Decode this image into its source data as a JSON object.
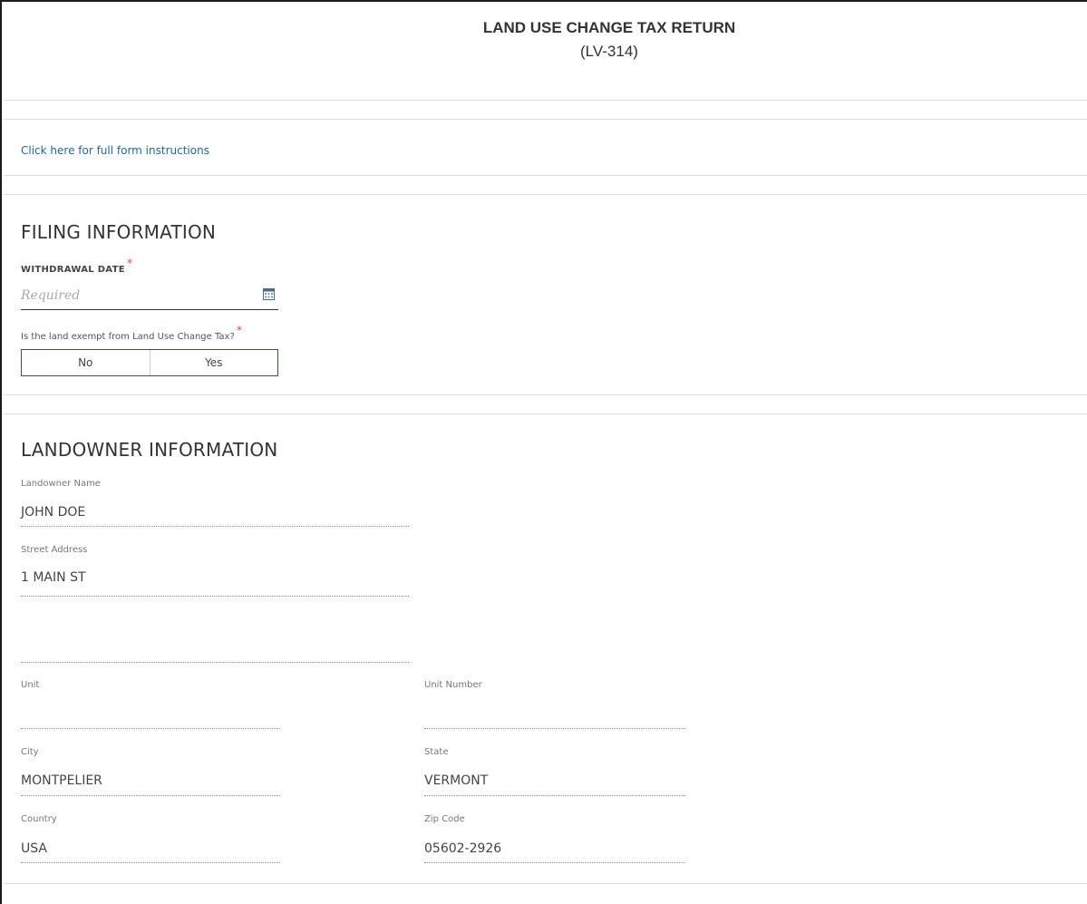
{
  "form": {
    "title": "LAND USE CHANGE TAX RETURN",
    "form_code": "(LV-314)",
    "instructions_link": "Click here for full form instructions"
  },
  "filing": {
    "heading": "FILING INFORMATION",
    "withdrawal_date_label": "WITHDRAWAL DATE",
    "required_mark": "*",
    "withdrawal_date_value": "",
    "withdrawal_date_placeholder": "Required",
    "exempt_question": "Is the land exempt from Land Use Change Tax?",
    "exempt_options": [
      "No",
      "Yes"
    ]
  },
  "landowner": {
    "heading": "LANDOWNER INFORMATION",
    "name_label": "Landowner Name",
    "name_value": "JOHN DOE",
    "street_label": "Street Address",
    "street_value": "1 MAIN ST",
    "street2_value": "",
    "unit_label": "Unit",
    "unit_value": "",
    "unit_number_label": "Unit Number",
    "unit_number_value": "",
    "city_label": "City",
    "city_value": "MONTPELIER",
    "state_label": "State",
    "state_value": "VERMONT",
    "country_label": "Country",
    "country_value": "USA",
    "zip_label": "Zip Code",
    "zip_value": "05602-2926"
  },
  "colors": {
    "link": "#1e6aa0",
    "required_star": "#d9534f",
    "toggle_border": "#335c33"
  },
  "icons": {
    "date_picker": "calendar-icon"
  }
}
